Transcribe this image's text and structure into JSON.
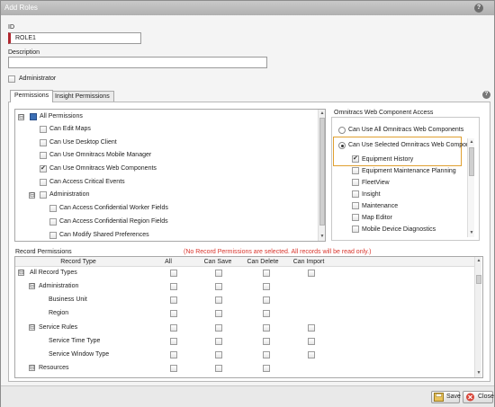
{
  "window": {
    "title": "Add Roles"
  },
  "form": {
    "id_label": "ID",
    "id_value": "ROLE1",
    "description_label": "Description",
    "description_value": "",
    "administrator_label": "Administrator"
  },
  "tabs": [
    {
      "label": "Permissions"
    },
    {
      "label": "Insight Permissions"
    }
  ],
  "permissions_tree": [
    {
      "label": "All Permissions",
      "checked": false
    },
    {
      "label": "Can Edit Maps",
      "checked": false
    },
    {
      "label": "Can Use Desktop Client",
      "checked": false
    },
    {
      "label": "Can Use Omnitracs Mobile Manager",
      "checked": false
    },
    {
      "label": "Can Use Omnitracs Web Components",
      "checked": true
    },
    {
      "label": "Can Access Critical Events",
      "checked": false
    },
    {
      "label": "Administration",
      "checked": false
    },
    {
      "label": "Can Access Confidential Worker Fields",
      "checked": false
    },
    {
      "label": "Can Access Confidential Region Fields",
      "checked": false
    },
    {
      "label": "Can Modify Shared Preferences",
      "checked": false
    }
  ],
  "web_access": {
    "title": "Omnitracs Web Component Access",
    "option_all": "Can Use All Omnitracs Web Components",
    "option_selected": "Can Use Selected Omnitracs Web Compor",
    "components": [
      {
        "label": "Equipment History",
        "checked": true
      },
      {
        "label": "Equipment Maintenance Planning",
        "checked": false
      },
      {
        "label": "FleetView",
        "checked": false
      },
      {
        "label": "Insight",
        "checked": false
      },
      {
        "label": "Maintenance",
        "checked": false
      },
      {
        "label": "Map Editor",
        "checked": false
      },
      {
        "label": "Mobile Device Diagnostics",
        "checked": false
      }
    ]
  },
  "record_permissions": {
    "title": "Record Permissions",
    "warning": "(No Record Permissions are selected.  All records will be read only.)",
    "warning_color": "#d9342b",
    "columns": [
      "Record Type",
      "All",
      "Can Save",
      "Can Delete",
      "Can Import"
    ],
    "rows": [
      {
        "label": "All Record Types",
        "level": 0,
        "expander": "⊟"
      },
      {
        "label": "Administration",
        "level": 1,
        "expander": "⊟"
      },
      {
        "label": "Business Unit",
        "level": 2,
        "expander": ""
      },
      {
        "label": "Region",
        "level": 2,
        "expander": ""
      },
      {
        "label": "Service Rules",
        "level": 1,
        "expander": "⊟"
      },
      {
        "label": "Service Time Type",
        "level": 2,
        "expander": ""
      },
      {
        "label": "Service Window Type",
        "level": 2,
        "expander": ""
      },
      {
        "label": "Resources",
        "level": 1,
        "expander": "⊟"
      }
    ]
  },
  "buttons": {
    "save": "Save",
    "close": "Close"
  },
  "icons": {
    "help": "?",
    "collapse": "⊟",
    "scroll_up": "▲",
    "scroll_down": "▼"
  }
}
